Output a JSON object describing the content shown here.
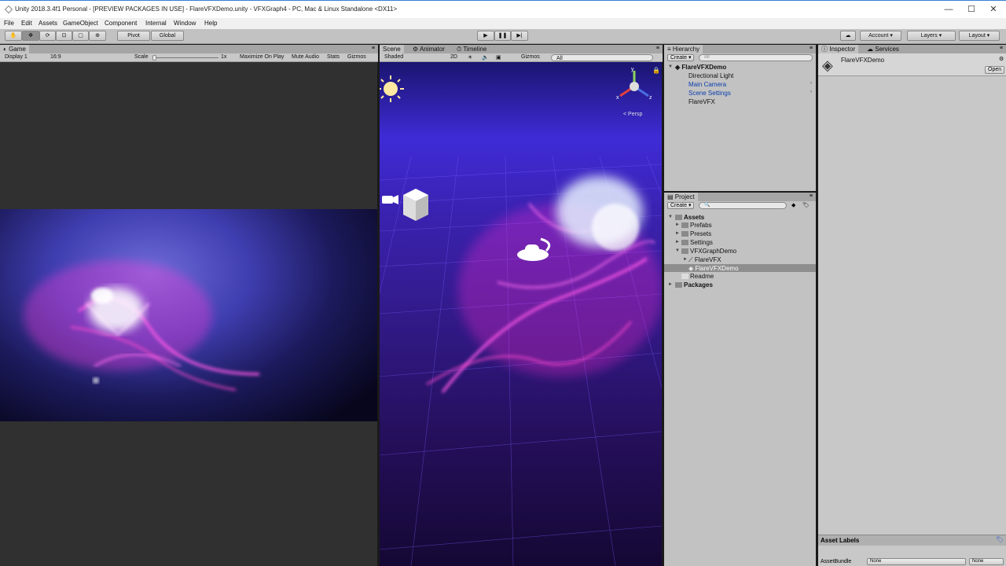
{
  "window": {
    "title": "Unity 2018.3.4f1 Personal - [PREVIEW PACKAGES IN USE] - FlareVFXDemo.unity - VFXGraph4 - PC, Mac & Linux Standalone <DX11>",
    "minimize": "—",
    "maximize": "☐",
    "close": "✕"
  },
  "menu": [
    "File",
    "Edit",
    "Assets",
    "GameObject",
    "Component",
    "Internal",
    "Window",
    "Help"
  ],
  "toolbar": {
    "pivot": "Pivot",
    "global": "Global",
    "account": "Account",
    "layers": "Layers",
    "layout": "Layout"
  },
  "game": {
    "tab": "Game",
    "display": "Display 1",
    "aspect": "16:9",
    "scale_label": "Scale",
    "scale_value": "1x",
    "maximize": "Maximize On Play",
    "mute": "Mute Audio",
    "stats": "Stats",
    "gizmos": "Gizmos"
  },
  "scene": {
    "tabs": [
      "Scene",
      "Animator",
      "Timeline"
    ],
    "shading": "Shaded",
    "mode2d": "2D",
    "gizmos": "Gizmos",
    "search": "All",
    "persp": "Persp",
    "axis_y": "y",
    "axis_x": "x",
    "axis_z": "z"
  },
  "hierarchy": {
    "tab": "Hierarchy",
    "create": "Create",
    "search": "All",
    "scene_name": "FlareVFXDemo",
    "items": [
      "Directional Light",
      "Main Camera",
      "Scene Settings",
      "FlareVFX"
    ]
  },
  "project": {
    "tab": "Project",
    "create": "Create",
    "assets": "Assets",
    "folders": [
      "Prefabs",
      "Presets",
      "Settings",
      "VFXGraphDemo"
    ],
    "vfx_items": [
      "FlareVFX",
      "FlareVFXDemo"
    ],
    "readme": "Readme",
    "packages": "Packages"
  },
  "inspector": {
    "tabs": [
      "Inspector",
      "Services"
    ],
    "asset_name": "FlareVFXDemo",
    "open": "Open",
    "asset_labels": "Asset Labels",
    "asset_bundle": "AssetBundle",
    "bundle_value": "None",
    "variant_value": "None"
  }
}
